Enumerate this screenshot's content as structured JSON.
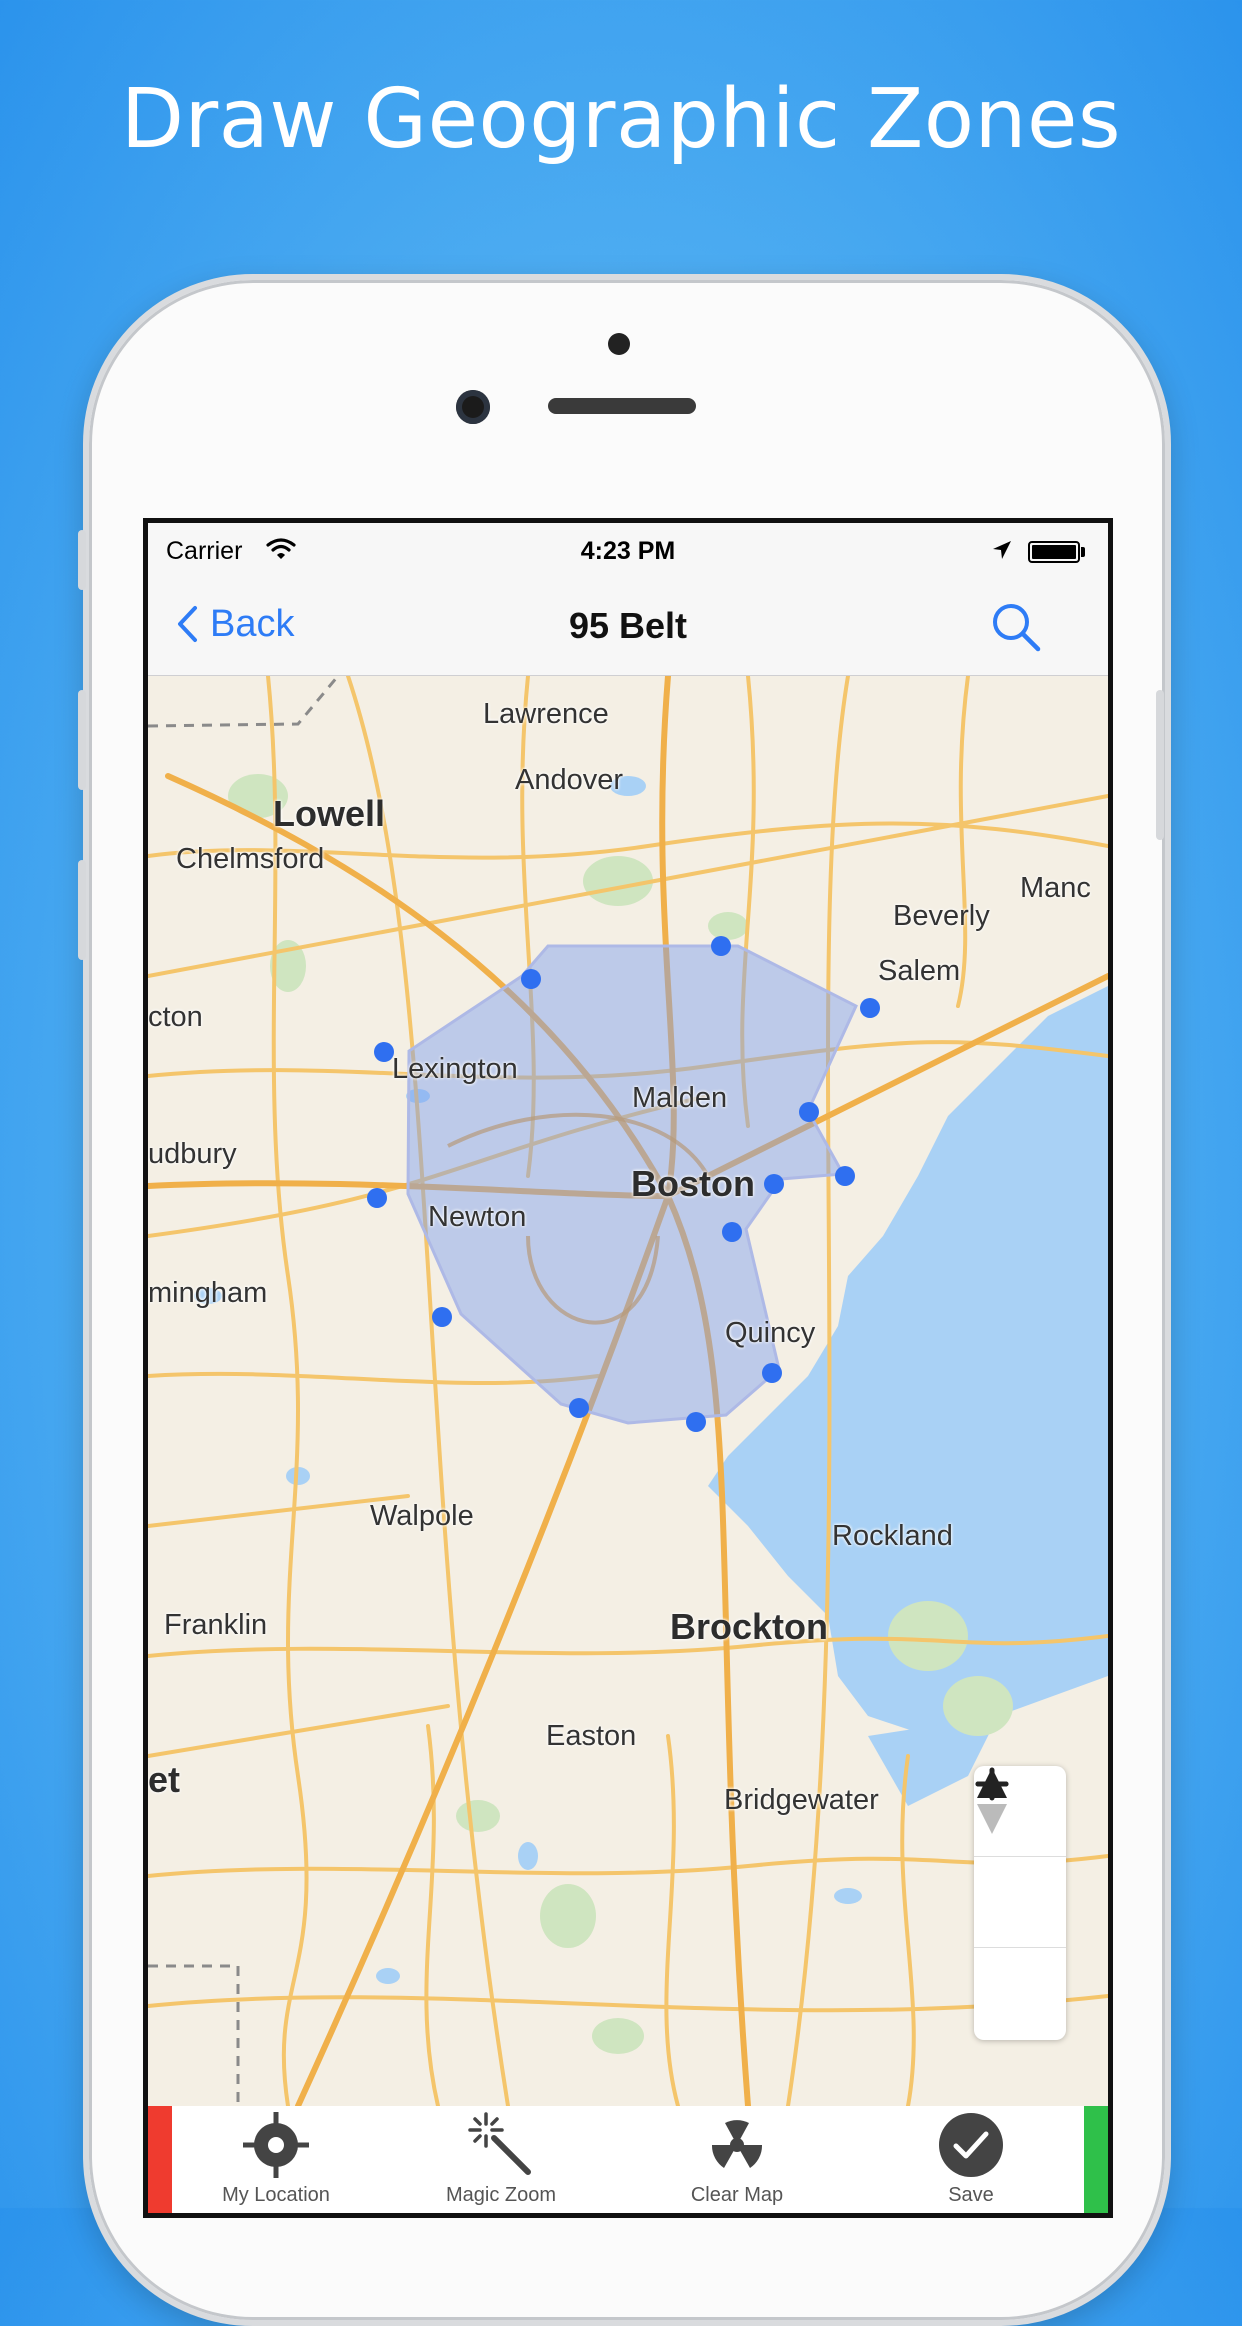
{
  "headline": "Draw Geographic Zones",
  "status_bar": {
    "carrier": "Carrier",
    "time": "4:23 PM"
  },
  "nav": {
    "back_label": "Back",
    "title": "95 Belt"
  },
  "map": {
    "labels": {
      "lawrence": "Lawrence",
      "andover": "Andover",
      "lowell": "Lowell",
      "chelmsford": "Chelmsford",
      "manc": "Manc",
      "beverly": "Beverly",
      "salem": "Salem",
      "cton": "cton",
      "lexington": "Lexington",
      "malden": "Malden",
      "udbury": "udbury",
      "boston": "Boston",
      "newton": "Newton",
      "mingham": "mingham",
      "quincy": "Quincy",
      "walpole": "Walpole",
      "rockland": "Rockland",
      "franklin": "Franklin",
      "brockton": "Brockton",
      "easton": "Easton",
      "bridgewater": "Bridgewater",
      "et": "et"
    },
    "zone_fill": "#7b9df0",
    "vertex_color": "#2f6ff0"
  },
  "toolbar": {
    "my_location": "My Location",
    "magic_zoom": "Magic Zoom",
    "clear_map": "Clear Map",
    "save": "Save"
  },
  "colors": {
    "accent": "#2e7cf6",
    "edge_red": "#ef3b2f",
    "edge_green": "#2fc04a"
  }
}
